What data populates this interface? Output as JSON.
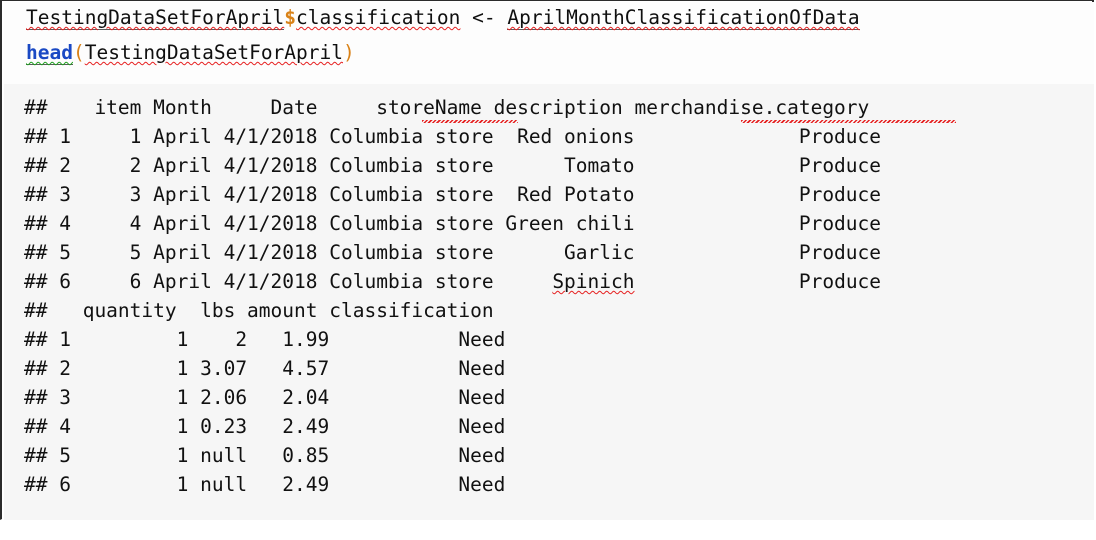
{
  "window": {
    "kind": "r-markdown-console-chunk",
    "background": "#f6f6f6",
    "code_background": "#fdfdfd",
    "border_color": "#2b2b2b",
    "text_color": "#0f0f0f",
    "accent_orange": "#d98218",
    "accent_blue": "#1a49c4",
    "spell_error_color": "#e62020",
    "grammar_error_color": "#1d9e1d"
  },
  "code": {
    "line1": {
      "object": "TestingDataSetForApril",
      "dollar": "$",
      "field": "classification",
      "space1": " ",
      "assign": "<-",
      "space2": " ",
      "value": "AprilMonthClassificationOfData"
    },
    "line2": {
      "fn": "head",
      "open_paren": "(",
      "arg": "TestingDataSetForApril",
      "close_paren": ")"
    }
  },
  "output": {
    "prefix": "##",
    "block1": {
      "header": "##    item Month     Date     storeName description merchandise.category",
      "header_label_item": "item",
      "header_label_month": "Month",
      "header_label_date": "Date",
      "header_label_storename": "storeName",
      "header_label_description": "description",
      "header_label_category": "merchandise.category",
      "rows": [
        "## 1     1 April 4/1/2018 Columbia store  Red onions              Produce",
        "## 2     2 April 4/1/2018 Columbia store      Tomato              Produce",
        "## 3     3 April 4/1/2018 Columbia store  Red Potato              Produce",
        "## 4     4 April 4/1/2018 Columbia store Green chili              Produce",
        "## 5     5 April 4/1/2018 Columbia store      Garlic              Produce"
      ],
      "row6_pre": "## 6     6 April 4/1/2018 Columbia store     ",
      "row6_spinich": "Spinich",
      "row6_post": "              Produce"
    },
    "block2": {
      "header": "##   quantity  lbs amount classification",
      "header_label_quantity": "quantity",
      "header_label_lbs": "lbs",
      "header_label_amount": "amount",
      "header_label_classification": "classification",
      "rows": [
        "## 1         1    2   1.99           Need",
        "## 2         1 3.07   4.57           Need",
        "## 3         1 2.06   2.04           Need",
        "## 4         1 0.23   2.49           Need",
        "## 5         1 null   0.85           Need",
        "## 6         1 null   2.49           Need"
      ]
    },
    "records": [
      {
        "index": "1",
        "item": "1",
        "month": "April",
        "date": "4/1/2018",
        "storeName": "Columbia store",
        "description": "Red onions",
        "merchandise_category": "Produce",
        "quantity": "1",
        "lbs": "2",
        "amount": "1.99",
        "classification": "Need"
      },
      {
        "index": "2",
        "item": "2",
        "month": "April",
        "date": "4/1/2018",
        "storeName": "Columbia store",
        "description": "Tomato",
        "merchandise_category": "Produce",
        "quantity": "1",
        "lbs": "3.07",
        "amount": "4.57",
        "classification": "Need"
      },
      {
        "index": "3",
        "item": "3",
        "month": "April",
        "date": "4/1/2018",
        "storeName": "Columbia store",
        "description": "Red Potato",
        "merchandise_category": "Produce",
        "quantity": "1",
        "lbs": "2.06",
        "amount": "2.04",
        "classification": "Need"
      },
      {
        "index": "4",
        "item": "4",
        "month": "April",
        "date": "4/1/2018",
        "storeName": "Columbia store",
        "description": "Green chili",
        "merchandise_category": "Produce",
        "quantity": "1",
        "lbs": "0.23",
        "amount": "2.49",
        "classification": "Need"
      },
      {
        "index": "5",
        "item": "5",
        "month": "April",
        "date": "4/1/2018",
        "storeName": "Columbia store",
        "description": "Garlic",
        "merchandise_category": "Produce",
        "quantity": "1",
        "lbs": "null",
        "amount": "0.85",
        "classification": "Need"
      },
      {
        "index": "6",
        "item": "6",
        "month": "April",
        "date": "4/1/2018",
        "storeName": "Columbia store",
        "description": "Spinich",
        "merchandise_category": "Produce",
        "quantity": "1",
        "lbs": "null",
        "amount": "2.49",
        "classification": "Need"
      }
    ]
  }
}
